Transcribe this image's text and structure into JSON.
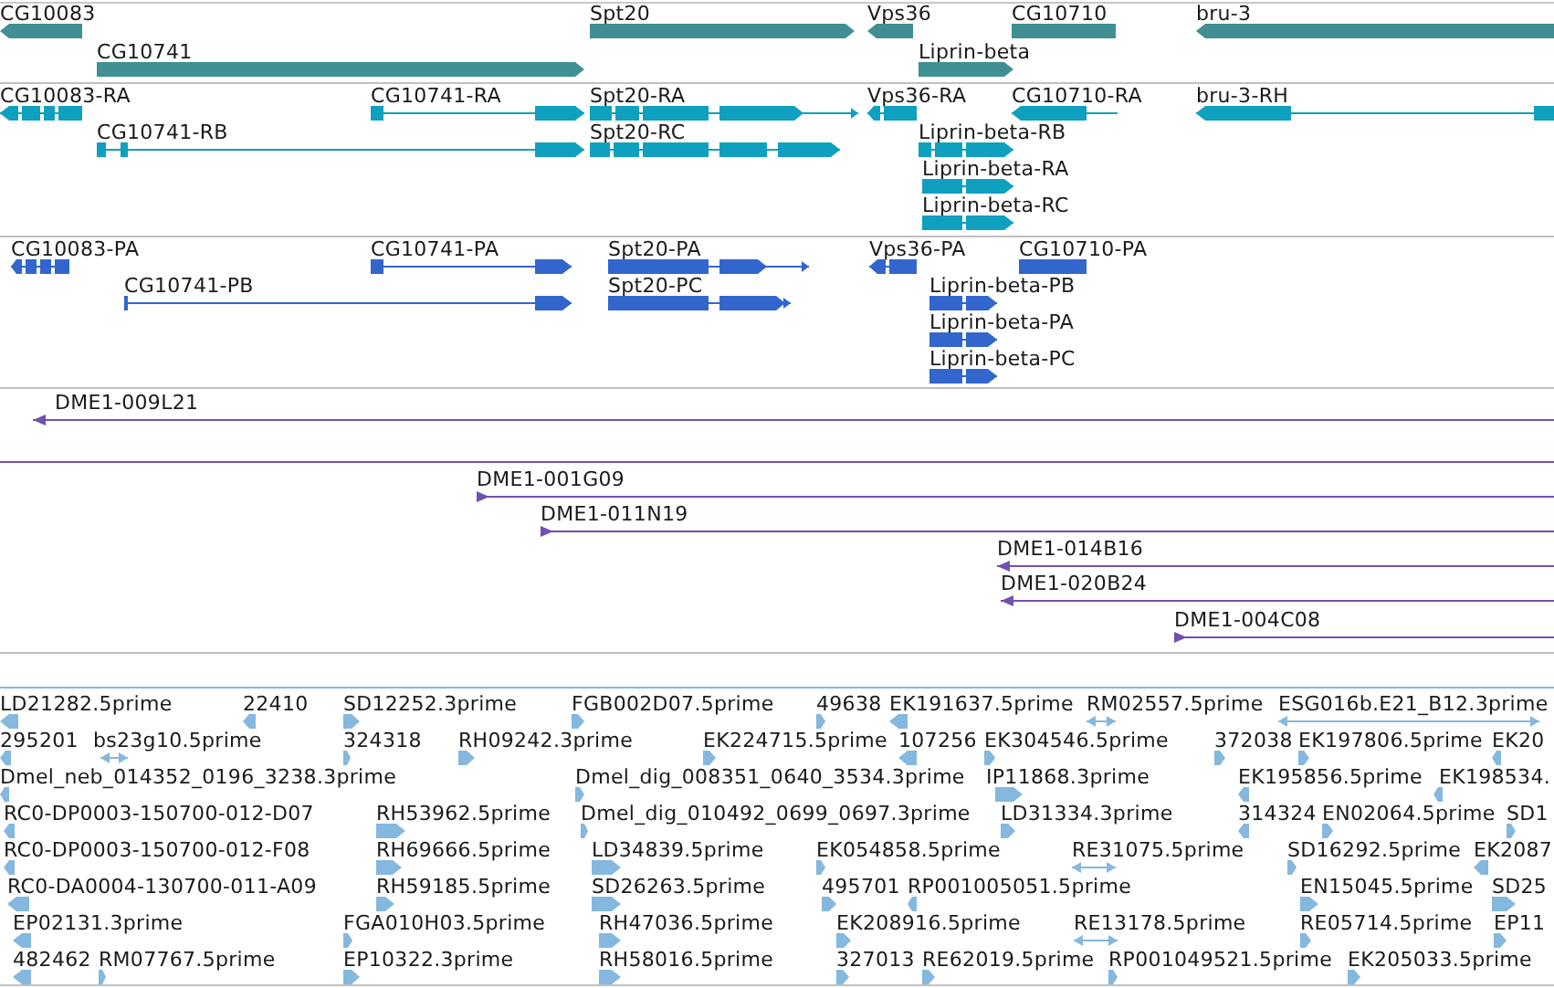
{
  "tracks": [
    {
      "kind": "gene",
      "features": [
        {
          "label": "CG10083",
          "arrow_left": true,
          "arrow_right": false
        },
        {
          "label": "Spt20",
          "arrow_left": false,
          "arrow_right": true
        },
        {
          "label": "Vps36",
          "arrow_left": true,
          "arrow_right": false
        },
        {
          "label": "CG10710",
          "arrow_left": false,
          "arrow_right": false
        },
        {
          "label": "bru-3",
          "arrow_left": true,
          "arrow_right": false
        },
        {
          "label": "CG10741",
          "arrow_left": false,
          "arrow_right": true
        },
        {
          "label": "Liprin-beta",
          "arrow_left": false,
          "arrow_right": true
        }
      ]
    },
    {
      "kind": "transcript",
      "features": [
        {
          "label": "CG10083-RA",
          "arrow_left": true,
          "arrow_right": false
        },
        {
          "label": "CG10741-RA",
          "arrow_left": false,
          "arrow_right": true
        },
        {
          "label": "Spt20-RA",
          "arrow_left": false,
          "arrow_right": true
        },
        {
          "label": "Vps36-RA",
          "arrow_left": true,
          "arrow_right": false
        },
        {
          "label": "CG10710-RA",
          "arrow_left": true,
          "arrow_right": false
        },
        {
          "label": "bru-3-RH",
          "arrow_left": true,
          "arrow_right": false
        },
        {
          "label": "CG10741-RB",
          "arrow_left": false,
          "arrow_right": true
        },
        {
          "label": "Spt20-RC",
          "arrow_left": false,
          "arrow_right": true
        },
        {
          "label": "Liprin-beta-RB",
          "arrow_left": false,
          "arrow_right": true
        },
        {
          "label": "Liprin-beta-RA",
          "arrow_left": false,
          "arrow_right": true
        },
        {
          "label": "Liprin-beta-RC",
          "arrow_left": false,
          "arrow_right": true
        }
      ]
    },
    {
      "kind": "protein",
      "features": [
        {
          "label": "CG10083-PA",
          "arrow_left": true,
          "arrow_right": false
        },
        {
          "label": "CG10741-PA",
          "arrow_left": false,
          "arrow_right": true
        },
        {
          "label": "Spt20-PA",
          "arrow_left": false,
          "arrow_right": true
        },
        {
          "label": "Vps36-PA",
          "arrow_left": true,
          "arrow_right": false
        },
        {
          "label": "CG10710-PA",
          "arrow_left": false,
          "arrow_right": false
        },
        {
          "label": "CG10741-PB",
          "arrow_left": false,
          "arrow_right": true
        },
        {
          "label": "Spt20-PC",
          "arrow_left": false,
          "arrow_right": true
        },
        {
          "label": "Liprin-beta-PB",
          "arrow_left": false,
          "arrow_right": true
        },
        {
          "label": "Liprin-beta-PA",
          "arrow_left": false,
          "arrow_right": true
        },
        {
          "label": "Liprin-beta-PC",
          "arrow_left": false,
          "arrow_right": true
        }
      ]
    },
    {
      "kind": "clone",
      "features": [
        {
          "label": "DME1-009L21",
          "arrow_left": true,
          "arrow_right": false
        },
        {
          "arrow_left": false,
          "arrow_right": false
        },
        {
          "label": "DME1-001G09",
          "arrow_left": false,
          "arrow_right": true
        },
        {
          "label": "DME1-011N19",
          "arrow_left": false,
          "arrow_right": true
        },
        {
          "label": "DME1-014B16",
          "arrow_left": true,
          "arrow_right": false
        },
        {
          "label": "DME1-020B24",
          "arrow_left": true,
          "arrow_right": false
        },
        {
          "label": "DME1-004C08",
          "arrow_left": false,
          "arrow_right": true
        }
      ]
    },
    {
      "kind": "est",
      "features": [
        {
          "label": "LD21282.5prime",
          "arrow_left": true,
          "arrow_right": false
        },
        {
          "label": "22410",
          "arrow_left": true,
          "arrow_right": false
        },
        {
          "label": "SD12252.3prime",
          "arrow_left": false,
          "arrow_right": true
        },
        {
          "label": "FGB002D07.5prime",
          "arrow_left": false,
          "arrow_right": true
        },
        {
          "label": "49638",
          "arrow_left": false,
          "arrow_right": true
        },
        {
          "label": "EK191637.5prime",
          "arrow_left": true,
          "arrow_right": false
        },
        {
          "label": "RM02557.5prime",
          "arrow_left": true,
          "arrow_right": true
        },
        {
          "label": "ESG016b.E21_B12.3prime",
          "arrow_left": true,
          "arrow_right": true
        },
        {
          "label": "295201",
          "arrow_left": true,
          "arrow_right": false
        },
        {
          "label": "bs23g10.5prime",
          "arrow_left": true,
          "arrow_right": true
        },
        {
          "label": "324318",
          "arrow_left": false,
          "arrow_right": true
        },
        {
          "label": "RH09242.3prime",
          "arrow_left": false,
          "arrow_right": true
        },
        {
          "label": "EK224715.5prime",
          "arrow_left": false,
          "arrow_right": true
        },
        {
          "label": "107256",
          "arrow_left": true,
          "arrow_right": false
        },
        {
          "label": "EK304546.5prime",
          "arrow_left": false,
          "arrow_right": true
        },
        {
          "label": "372038",
          "arrow_left": false,
          "arrow_right": true
        },
        {
          "label": "EK197806.5prime",
          "arrow_left": false,
          "arrow_right": true
        },
        {
          "label": "EK20",
          "arrow_left": true,
          "arrow_right": false
        },
        {
          "label": "Dmel_neb_014352_0196_3238.3prime",
          "arrow_left": true,
          "arrow_right": false
        },
        {
          "label": "Dmel_dig_008351_0640_3534.3prime",
          "arrow_left": false,
          "arrow_right": true
        },
        {
          "label": "IP11868.3prime",
          "arrow_left": false,
          "arrow_right": true
        },
        {
          "label": "EK195856.5prime",
          "arrow_left": true,
          "arrow_right": false
        },
        {
          "label": "EK198534.",
          "arrow_left": true,
          "arrow_right": false
        },
        {
          "label": "RC0-DP0003-150700-012-D07",
          "arrow_left": true,
          "arrow_right": false
        },
        {
          "label": "RH53962.5prime",
          "arrow_left": false,
          "arrow_right": true
        },
        {
          "label": "Dmel_dig_010492_0699_0697.3prime",
          "arrow_left": false,
          "arrow_right": true
        },
        {
          "label": "LD31334.3prime",
          "arrow_left": false,
          "arrow_right": true
        },
        {
          "label": "314324",
          "arrow_left": true,
          "arrow_right": false
        },
        {
          "label": "EN02064.5prime",
          "arrow_left": false,
          "arrow_right": true
        },
        {
          "label": "SD1",
          "arrow_left": false,
          "arrow_right": true
        },
        {
          "label": "RC0-DP0003-150700-012-F08",
          "arrow_left": true,
          "arrow_right": false
        },
        {
          "label": "RH69666.5prime",
          "arrow_left": false,
          "arrow_right": true
        },
        {
          "label": "LD34839.5prime",
          "arrow_left": false,
          "arrow_right": true
        },
        {
          "label": "EK054858.5prime",
          "arrow_left": false,
          "arrow_right": true
        },
        {
          "label": "RE31075.5prime",
          "arrow_left": true,
          "arrow_right": true
        },
        {
          "label": "SD16292.5prime",
          "arrow_left": false,
          "arrow_right": true
        },
        {
          "label": "EK2087",
          "arrow_left": true,
          "arrow_right": false
        },
        {
          "label": "RC0-DA0004-130700-011-A09",
          "arrow_left": true,
          "arrow_right": false
        },
        {
          "label": "RH59185.5prime",
          "arrow_left": false,
          "arrow_right": true
        },
        {
          "label": "SD26263.5prime",
          "arrow_left": false,
          "arrow_right": true
        },
        {
          "label": "495701",
          "arrow_left": false,
          "arrow_right": true
        },
        {
          "label": "RP001005051.5prime",
          "arrow_left": true,
          "arrow_right": false
        },
        {
          "label": "EN15045.5prime",
          "arrow_left": false,
          "arrow_right": true
        },
        {
          "label": "SD25",
          "arrow_left": false,
          "arrow_right": true
        },
        {
          "label": "EP02131.3prime",
          "arrow_left": true,
          "arrow_right": false
        },
        {
          "label": "FGA010H03.5prime",
          "arrow_left": false,
          "arrow_right": true
        },
        {
          "label": "RH47036.5prime",
          "arrow_left": false,
          "arrow_right": true
        },
        {
          "label": "EK208916.5prime",
          "arrow_left": false,
          "arrow_right": true
        },
        {
          "label": "RE13178.5prime",
          "arrow_left": true,
          "arrow_right": true
        },
        {
          "label": "RE05714.5prime",
          "arrow_left": false,
          "arrow_right": true
        },
        {
          "label": "EP11",
          "arrow_left": false,
          "arrow_right": true
        },
        {
          "label": "482462",
          "arrow_left": true,
          "arrow_right": false
        },
        {
          "label": "RM07767.5prime",
          "arrow_left": false,
          "arrow_right": true
        },
        {
          "label": "EP10322.3prime",
          "arrow_left": false,
          "arrow_right": true
        },
        {
          "label": "RH58016.5prime",
          "arrow_left": false,
          "arrow_right": true
        },
        {
          "label": "327013",
          "arrow_left": false,
          "arrow_right": true
        },
        {
          "label": "RE62019.5prime",
          "arrow_left": false,
          "arrow_right": true
        },
        {
          "label": "RP001049521.5prime",
          "arrow_left": false,
          "arrow_right": true
        },
        {
          "label": "EK205033.5prime",
          "arrow_left": false,
          "arrow_right": true
        }
      ]
    }
  ]
}
